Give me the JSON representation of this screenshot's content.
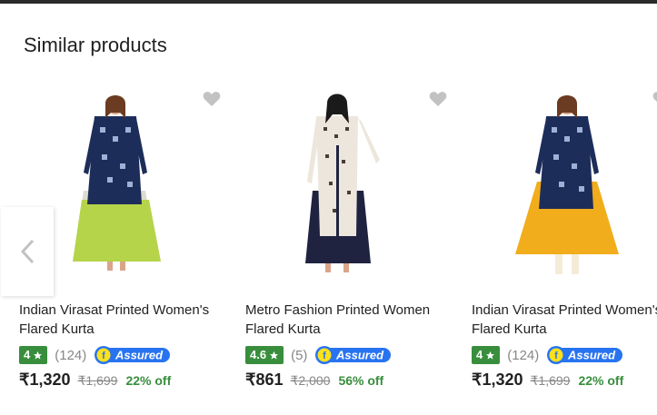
{
  "section": {
    "title": "Similar products"
  },
  "products": [
    {
      "name": "Indian Virasat Printed Women's Flared Kurta",
      "rating": "4",
      "reviews": "(124)",
      "price": "₹1,320",
      "mrp": "₹1,699",
      "discount": "22% off",
      "skirt_color": "#b5d44a"
    },
    {
      "name": "Metro Fashion Printed Women Flared Kurta",
      "rating": "4.6",
      "reviews": "(5)",
      "price": "₹861",
      "mrp": "₹2,000",
      "discount": "56% off",
      "skirt_color": "#1f2340"
    },
    {
      "name": "Indian Virasat Printed Women's Flared Kurta",
      "rating": "4",
      "reviews": "(124)",
      "price": "₹1,320",
      "mrp": "₹1,699",
      "discount": "22% off",
      "skirt_color": "#f1ad1c"
    }
  ],
  "assured_label": "Assured",
  "icons": {
    "wishlist": "heart-icon",
    "prev": "chevron-left-icon",
    "rating": "star-icon",
    "assured": "flipkart-assured-icon"
  },
  "colors": {
    "rating_badge": "#388e3c",
    "assured_blue": "#2874f0",
    "assured_yellow": "#ffe11b",
    "discount": "#388e3c",
    "heart": "#c2c2c2"
  }
}
